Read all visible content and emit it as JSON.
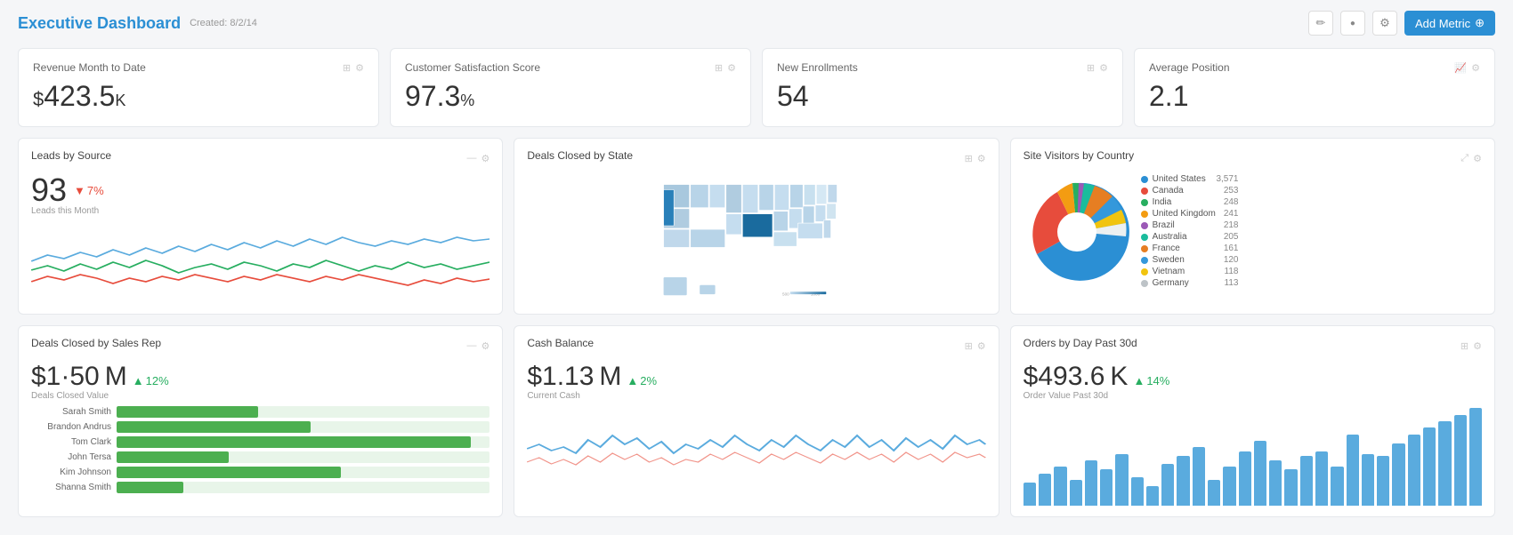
{
  "header": {
    "title": "Executive Dashboard",
    "created": "Created: 8/2/14",
    "edit_icon": "✏",
    "circle_icon": "●",
    "gear_icon": "⚙",
    "add_metric_label": "Add Metric",
    "plus_icon": "+"
  },
  "metrics": [
    {
      "id": "revenue",
      "title": "Revenue Month to Date",
      "value": "$423.5",
      "unit": "K",
      "has_currency": true
    },
    {
      "id": "csat",
      "title": "Customer Satisfaction Score",
      "value": "97.3",
      "unit": "%",
      "has_currency": false
    },
    {
      "id": "enrollments",
      "title": "New Enrollments",
      "value": "54",
      "unit": "",
      "has_currency": false
    },
    {
      "id": "avg_position",
      "title": "Average Position",
      "value": "2.1",
      "unit": "",
      "has_currency": false
    }
  ],
  "charts_row": {
    "leads": {
      "title": "Leads by Source",
      "value": "93",
      "change": "7%",
      "change_direction": "down",
      "sub_label": "Leads this Month"
    },
    "deals_map": {
      "title": "Deals Closed by State"
    },
    "visitors": {
      "title": "Site Visitors by Country",
      "countries": [
        {
          "name": "United States",
          "value": "3,571",
          "color": "#2b8fd4"
        },
        {
          "name": "Canada",
          "value": "253",
          "color": "#e74c3c"
        },
        {
          "name": "India",
          "value": "248",
          "color": "#27ae60"
        },
        {
          "name": "United Kingdom",
          "value": "241",
          "color": "#f39c12"
        },
        {
          "name": "Brazil",
          "value": "218",
          "color": "#9b59b6"
        },
        {
          "name": "Australia",
          "value": "205",
          "color": "#1abc9c"
        },
        {
          "name": "France",
          "value": "161",
          "color": "#e67e22"
        },
        {
          "name": "Sweden",
          "value": "120",
          "color": "#3498db"
        },
        {
          "name": "Vietnam",
          "value": "118",
          "color": "#f1c40f"
        },
        {
          "name": "Germany",
          "value": "113",
          "color": "#ecf0f1"
        }
      ]
    }
  },
  "bottom_row": {
    "sales_rep": {
      "title": "Deals Closed by Sales Rep",
      "value": "$1.50",
      "unit": "M",
      "change": "12%",
      "change_direction": "up",
      "sub_label": "Deals Closed Value",
      "reps": [
        {
          "name": "Sarah Smith",
          "pct": 38
        },
        {
          "name": "Brandon Andrus",
          "pct": 52
        },
        {
          "name": "Tom Clark",
          "pct": 95
        },
        {
          "name": "John Tersa",
          "pct": 30
        },
        {
          "name": "Kim Johnson",
          "pct": 60
        },
        {
          "name": "Shanna Smith",
          "pct": 18
        }
      ]
    },
    "cash": {
      "title": "Cash Balance",
      "value": "$1.13",
      "unit": "M",
      "change": "2%",
      "change_direction": "up",
      "sub_label": "Current Cash"
    },
    "orders": {
      "title": "Orders by Day Past 30d",
      "value": "$493.6",
      "unit": "K",
      "change": "14%",
      "change_direction": "up",
      "sub_label": "Order Value Past 30d",
      "bars": [
        18,
        25,
        30,
        20,
        35,
        28,
        40,
        22,
        15,
        32,
        38,
        45,
        20,
        30,
        42,
        50,
        35,
        28,
        38,
        42,
        30,
        55,
        40,
        38,
        48,
        55,
        60,
        65,
        70,
        75
      ]
    }
  }
}
